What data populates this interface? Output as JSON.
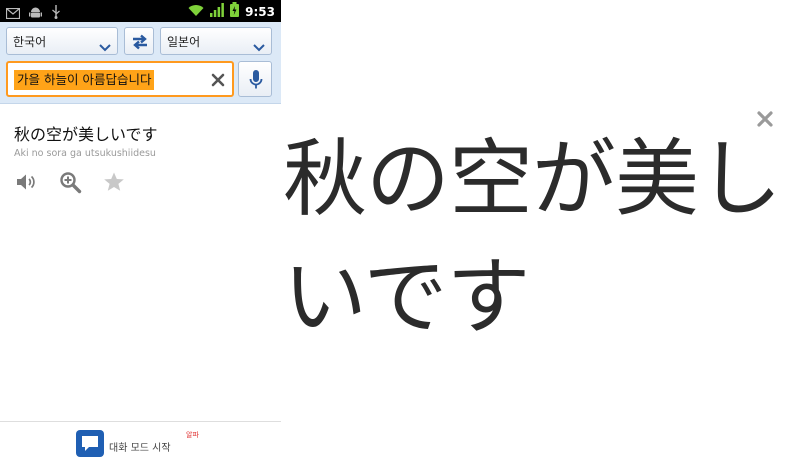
{
  "status_bar": {
    "time": "9:53",
    "left_icons": [
      "mail-icon",
      "android-icon",
      "usb-icon"
    ],
    "right_icons": [
      "wifi-icon",
      "signal-icon",
      "battery-icon"
    ]
  },
  "toolbar": {
    "source_language": "한국어",
    "target_language": "일본어",
    "swap_icon": "swap-arrows-icon",
    "input_value": "가을 하늘이 아름답습니다",
    "clear_icon": "clear-x-icon",
    "mic_icon": "microphone-icon"
  },
  "result": {
    "translation": "秋の空が美しいです",
    "romanization": "Aki no sora ga utsukushiidesu",
    "actions": [
      "speaker-icon",
      "zoom-icon",
      "star-icon"
    ]
  },
  "footer": {
    "conversation_label": "대화 모드 시작",
    "badge": "알파",
    "icon": "chat-bubble-icon"
  },
  "fullscreen": {
    "text": "秋の空が美しいです",
    "close_icon": "close-icon"
  },
  "colors": {
    "accent_orange": "#ffa318",
    "toolbar_bg": "#dce9f7",
    "chat_icon_blue": "#1f5fb3",
    "badge_red": "#e03030"
  }
}
